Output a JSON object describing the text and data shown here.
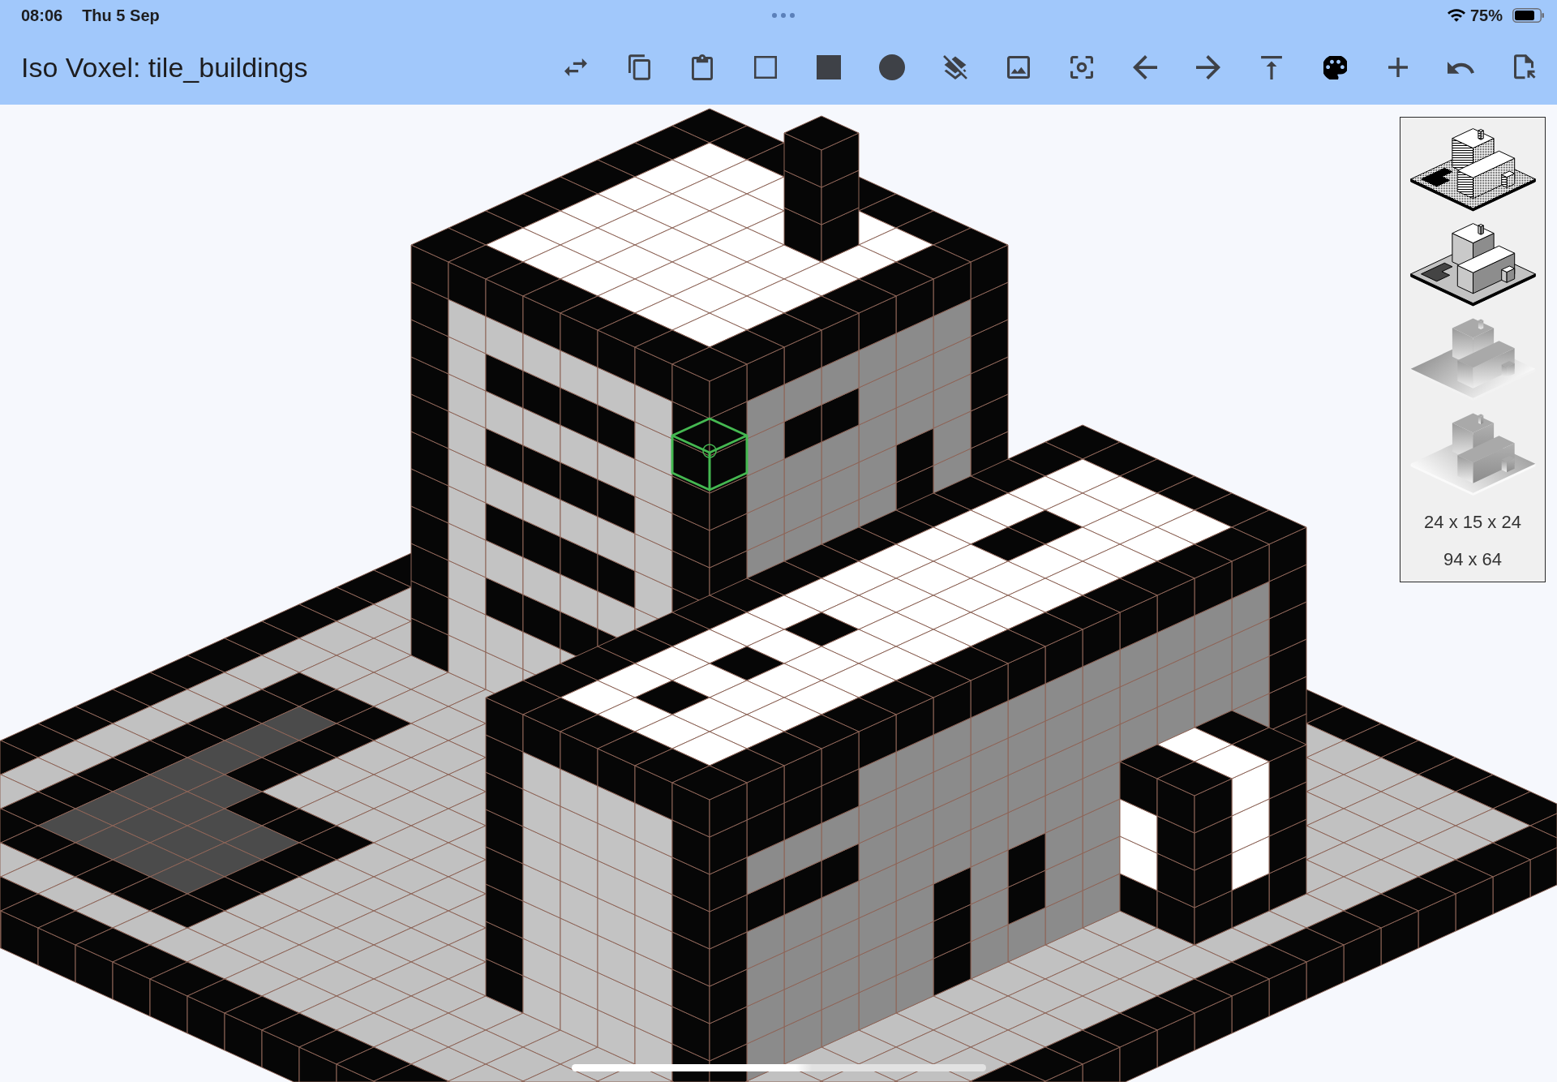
{
  "status_bar": {
    "time": "08:06",
    "date": "Thu 5 Sep",
    "battery": "75%"
  },
  "toolbar": {
    "title": "Iso Voxel: tile_buildings"
  },
  "side_panel": {
    "previews": [
      {
        "kind": "dithered"
      },
      {
        "kind": "shaded"
      },
      {
        "kind": "depth"
      },
      {
        "kind": "depth_reversed"
      }
    ],
    "dimensions": "24 x 15 x 24",
    "image_size": "94 x 64"
  }
}
